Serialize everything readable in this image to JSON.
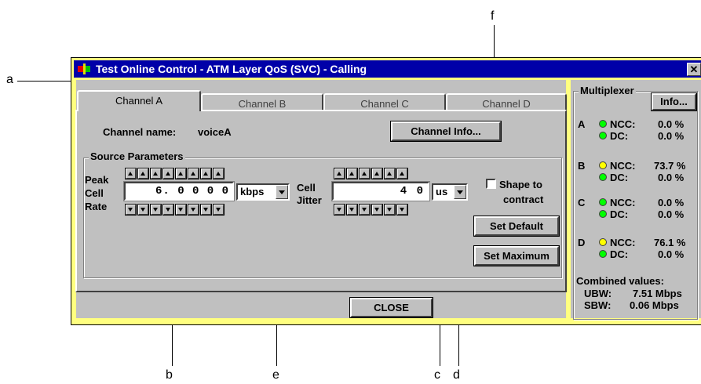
{
  "window": {
    "title": "Test Online Control - ATM Layer QoS (SVC) - Calling",
    "close_glyph": "✕"
  },
  "tabs": [
    {
      "label": "Channel A"
    },
    {
      "label": "Channel B"
    },
    {
      "label": "Channel C"
    },
    {
      "label": "Channel D"
    }
  ],
  "channel": {
    "name_label": "Channel name:",
    "name_value": "voiceA",
    "info_button": "Channel Info..."
  },
  "source": {
    "group_title": "Source Parameters",
    "pcr_label_1": "Peak",
    "pcr_label_2": "Cell",
    "pcr_label_3": "Rate",
    "pcr_value": "6. 0 0 0 0",
    "pcr_unit": "kbps",
    "jitter_label_1": "Cell",
    "jitter_label_2": "Jitter",
    "jitter_value": "4 0",
    "jitter_unit": "us",
    "shape_label_1": "Shape to",
    "shape_label_2": "contract",
    "set_default": "Set Default",
    "set_maximum": "Set Maximum"
  },
  "close_button": "CLOSE",
  "multiplexer": {
    "title": "Multiplexer",
    "info_button": "Info...",
    "channels": [
      {
        "id": "A",
        "ncc_label": "NCC:",
        "ncc_value": "0.0 %",
        "dc_label": "DC:",
        "dc_value": "0.0 %",
        "ncc_led": "#00ff00",
        "dc_led": "#00ff00"
      },
      {
        "id": "B",
        "ncc_label": "NCC:",
        "ncc_value": "73.7 %",
        "dc_label": "DC:",
        "dc_value": "0.0 %",
        "ncc_led": "#ffff00",
        "dc_led": "#00ff00"
      },
      {
        "id": "C",
        "ncc_label": "NCC:",
        "ncc_value": "0.0 %",
        "dc_label": "DC:",
        "dc_value": "0.0 %",
        "ncc_led": "#00ff00",
        "dc_led": "#00ff00"
      },
      {
        "id": "D",
        "ncc_label": "NCC:",
        "ncc_value": "76.1 %",
        "dc_label": "DC:",
        "dc_value": "0.0 %",
        "ncc_led": "#ffff00",
        "dc_led": "#00ff00"
      }
    ],
    "combined_title": "Combined values:",
    "ubw_label": "UBW:",
    "ubw_value": "7.51 Mbps",
    "sbw_label": "SBW:",
    "sbw_value": "0.06 Mbps"
  },
  "callouts": {
    "a": "a",
    "b": "b",
    "c": "c",
    "d": "d",
    "e": "e",
    "f": "f"
  },
  "colors": {
    "title_bar": "#0000a8",
    "window_frame": "#ffff80",
    "face": "#c0c0c0"
  }
}
